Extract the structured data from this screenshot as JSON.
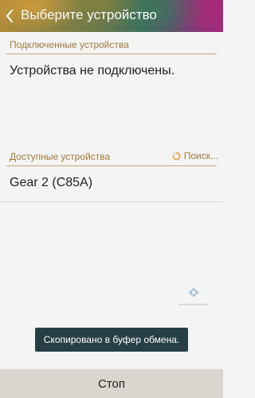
{
  "header": {
    "title": "Выберите устройство",
    "back_icon": "chevron-left-icon"
  },
  "connected": {
    "label": "Подключенные устройства",
    "empty_text": "Устройства не подключены."
  },
  "available": {
    "label": "Доступные устройства",
    "status_text": "Поиск...",
    "status_icon": "loading-spinner-icon",
    "devices": [
      {
        "name": "Gear 2 (C85A)"
      }
    ]
  },
  "toast": {
    "text": "Скопировано в буфер обмена."
  },
  "bottom_bar": {
    "stop_label": "Стоп"
  },
  "colors": {
    "section_accent": "#a2793c",
    "toast_bg": "#263f46",
    "bottom_bar_bg": "#d9d5cf"
  }
}
